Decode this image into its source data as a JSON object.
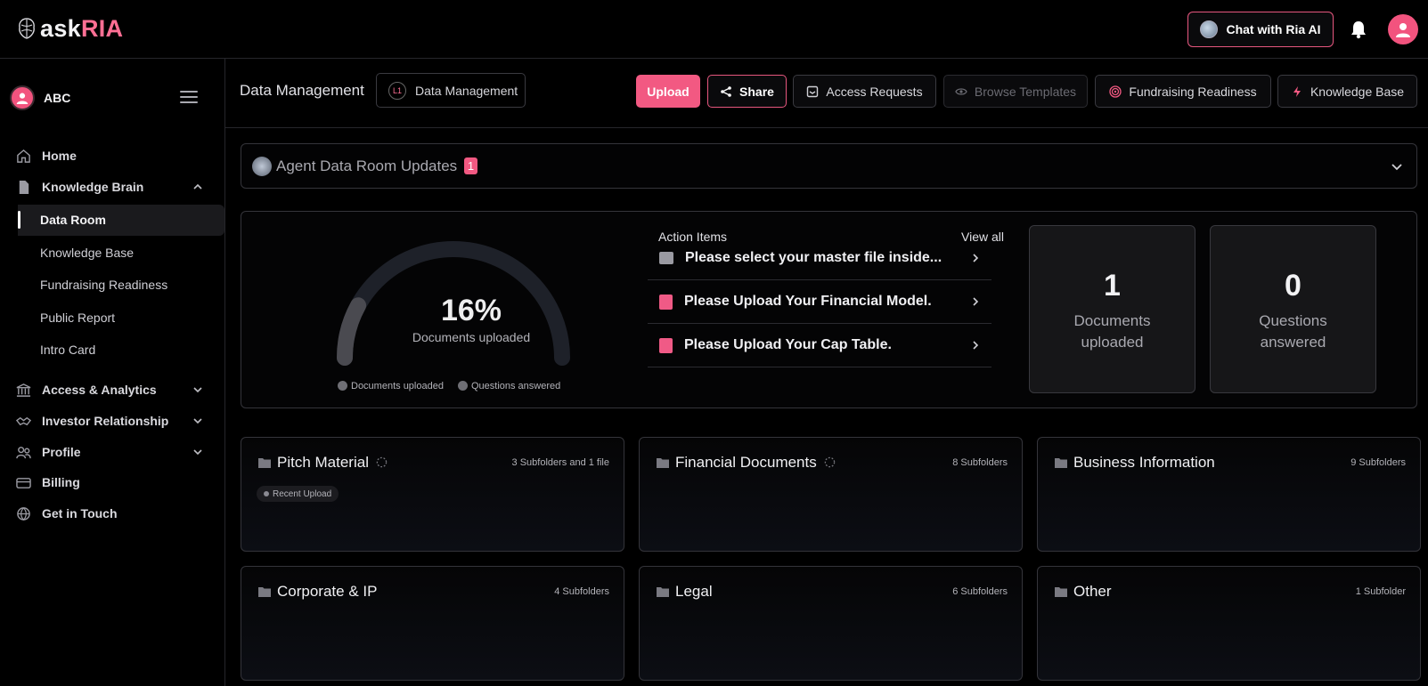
{
  "brand": {
    "name_part1": "ask",
    "name_part2": "RIA"
  },
  "topbar": {
    "chat_label": "Chat with Ria AI"
  },
  "sidebar": {
    "profile_name": "ABC",
    "items": [
      {
        "label": "Home",
        "icon": "home-icon"
      },
      {
        "label": "Knowledge Brain",
        "icon": "file-icon"
      },
      {
        "label": "Access & Analytics",
        "icon": "bank-icon"
      },
      {
        "label": "Investor Relationship",
        "icon": "handshake-icon"
      },
      {
        "label": "Profile",
        "icon": "users-icon"
      },
      {
        "label": "Billing",
        "icon": "card-icon"
      },
      {
        "label": "Get in Touch",
        "icon": "globe-icon"
      }
    ],
    "subitems": [
      "Data Room",
      "Knowledge Base",
      "Fundraising Readiness",
      "Public Report",
      "Intro Card"
    ]
  },
  "header": {
    "title": "Data Management",
    "crumb_badge": "L1",
    "crumb_label": "Data Management",
    "buttons": {
      "upload": "Upload",
      "share": "Share",
      "access": "Access Requests",
      "browse": "Browse Templates",
      "fundraising": "Fundraising Readiness",
      "kb": "Knowledge Base"
    }
  },
  "updates": {
    "title": "Agent Data Room Updates",
    "count": "1"
  },
  "progress": {
    "percent_label": "16%",
    "percent": 16,
    "sub": "Documents uploaded",
    "legend": [
      "Documents uploaded",
      "Questions answered"
    ]
  },
  "action_items": {
    "title": "Action Items",
    "view_all": "View all",
    "items": [
      "Please select your master file inside...",
      "Please Upload Your Financial Model.",
      "Please Upload Your Cap Table."
    ]
  },
  "stats": [
    {
      "value": "1",
      "label_1": "Documents",
      "label_2": "uploaded"
    },
    {
      "value": "0",
      "label_1": "Questions",
      "label_2": "answered"
    }
  ],
  "folders": [
    {
      "name": "Pitch Material",
      "meta": "3 Subfolders and 1 file",
      "tag": "Recent Upload"
    },
    {
      "name": "Financial Documents",
      "meta": "8 Subfolders"
    },
    {
      "name": "Business Information",
      "meta": "9 Subfolders"
    },
    {
      "name": "Corporate & IP",
      "meta": "4 Subfolders"
    },
    {
      "name": "Legal",
      "meta": "6 Subfolders"
    },
    {
      "name": "Other",
      "meta": "1 Subfolder"
    }
  ],
  "colors": {
    "accent": "#f25982",
    "background": "#000000"
  }
}
